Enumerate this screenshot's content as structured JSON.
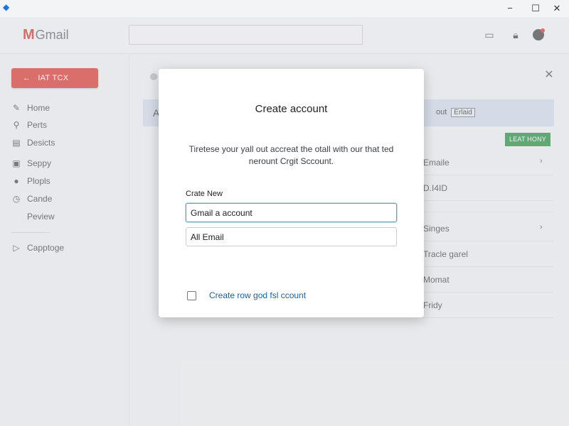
{
  "header": {
    "logo_letter": "M",
    "logo_text": "Gmail",
    "search_placeholder": ""
  },
  "sidebar": {
    "compose_label": "IAT TCX",
    "items": [
      {
        "label": "Home",
        "icon": "pencil-icon"
      },
      {
        "label": "Perts",
        "icon": "pin-icon"
      },
      {
        "label": "Desicts",
        "icon": "inbox-icon"
      },
      {
        "label": "Seppy",
        "icon": "sent-icon"
      },
      {
        "label": "Plopls",
        "icon": "contact-icon"
      },
      {
        "label": "Cande",
        "icon": "clock-icon"
      },
      {
        "label": "Peview",
        "icon": ""
      }
    ],
    "extra_item": {
      "label": "Capptoge",
      "icon": "play-icon"
    }
  },
  "main": {
    "banner_letter": "A",
    "banner_text": "out",
    "banner_tag": "Erlaid",
    "green_button": "LEAT HONY",
    "list": [
      {
        "text": "Emaile",
        "chevron": true
      },
      {
        "text": "D.I4ID",
        "chevron": false
      },
      {
        "text": "Singes",
        "chevron": true
      },
      {
        "text": "Tracle garel",
        "chevron": false
      },
      {
        "text": "Momat",
        "chevron": false
      },
      {
        "text": "Fridy",
        "chevron": false
      }
    ]
  },
  "dialog": {
    "title": "Create account",
    "description": "Tiretese your yall out accreat the otall with our that ted nerount Crgit Sccount.",
    "field_label": "Crate New",
    "input1_value": "Gmail a account",
    "input2_value": "All Email",
    "checkbox_label": "Create row god fsl ccount"
  },
  "colors": {
    "compose_bg": "#d9332b",
    "green_button": "#1e8e3e",
    "link": "#1a5f9e",
    "banner_bg": "#cfdbe8"
  }
}
